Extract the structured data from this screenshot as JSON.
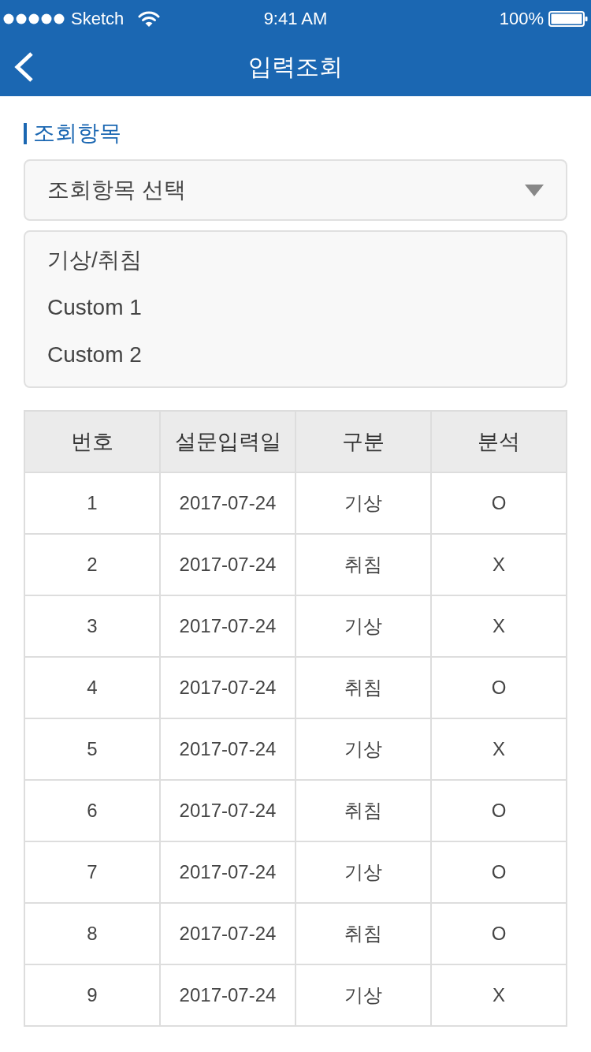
{
  "status_bar": {
    "carrier": "Sketch",
    "time": "9:41 AM",
    "battery": "100%"
  },
  "nav_bar": {
    "title": "입력조회"
  },
  "section": {
    "title": "조회항목"
  },
  "dropdown": {
    "placeholder": "조회항목 선택",
    "expanded": true,
    "options": [
      {
        "label": "기상/취침",
        "selected": false
      },
      {
        "label": "Custom 1",
        "selected": false
      },
      {
        "label": "Custom 2",
        "selected": false
      }
    ]
  },
  "table": {
    "columns": [
      "번호",
      "설문입력일",
      "구분",
      "분석"
    ],
    "rows": [
      [
        "1",
        "2017-07-24",
        "기상",
        "O"
      ],
      [
        "2",
        "2017-07-24",
        "취침",
        "X"
      ],
      [
        "3",
        "2017-07-24",
        "기상",
        "X"
      ],
      [
        "4",
        "2017-07-24",
        "취침",
        "O"
      ],
      [
        "5",
        "2017-07-24",
        "기상",
        "X"
      ],
      [
        "6",
        "2017-07-24",
        "취침",
        "O"
      ],
      [
        "7",
        "2017-07-24",
        "기상",
        "O"
      ],
      [
        "8",
        "2017-07-24",
        "취침",
        "O"
      ],
      [
        "9",
        "2017-07-24",
        "기상",
        "X"
      ]
    ]
  }
}
